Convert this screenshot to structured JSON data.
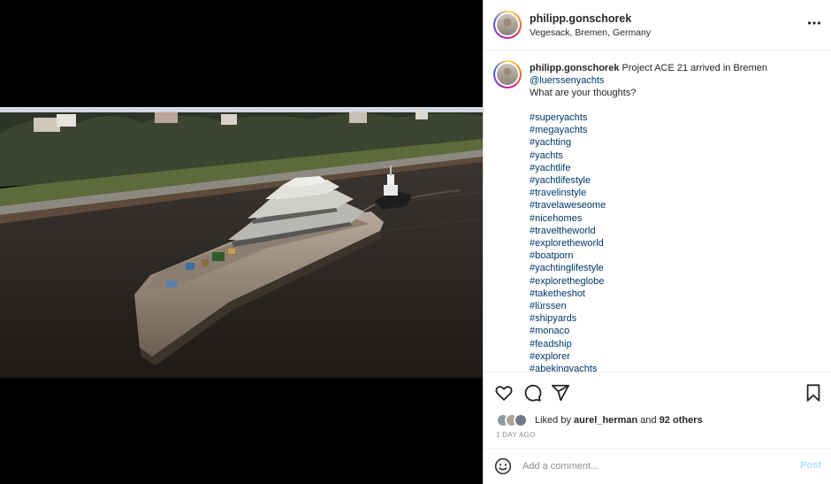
{
  "post": {
    "username": "philipp.gonschorek",
    "location": "Vegesack, Bremen, Germany",
    "caption_text": "Project ACE 21 arrived in Bremen",
    "mention": "@luerssenyachts",
    "question": "What are your thoughts?",
    "hashtags": [
      "#superyachts",
      "#megayachts",
      "#yachting",
      "#yachts",
      "#yachtlife",
      "#yachtlifestyle",
      "#travelinstyle",
      "#travelaweseome",
      "#nicehomes",
      "#traveltheworld",
      "#exploretheworld",
      "#boatporn",
      "#yachtinglifestyle",
      "#exploretheglobe",
      "#taketheshot",
      "#lürssen",
      "#shipyards",
      "#monaco",
      "#feadship",
      "#explorer",
      "#abekingyachts"
    ],
    "liked_by_prefix": "Liked by",
    "liked_by_user": "aurel_herman",
    "liked_by_and": "and",
    "liked_by_others": "92 others",
    "time_ago": "1 DAY AGO"
  },
  "comment_box": {
    "placeholder": "Add a comment...",
    "post_label": "Post"
  },
  "icons": {
    "more": "more-icon",
    "like": "heart-icon",
    "comment": "comment-icon",
    "share": "share-icon",
    "save": "bookmark-icon",
    "emoji": "emoji-icon"
  },
  "colors": {
    "link": "#00376b",
    "post_disabled": "#b2dffc",
    "muted": "#8e8e8e"
  }
}
